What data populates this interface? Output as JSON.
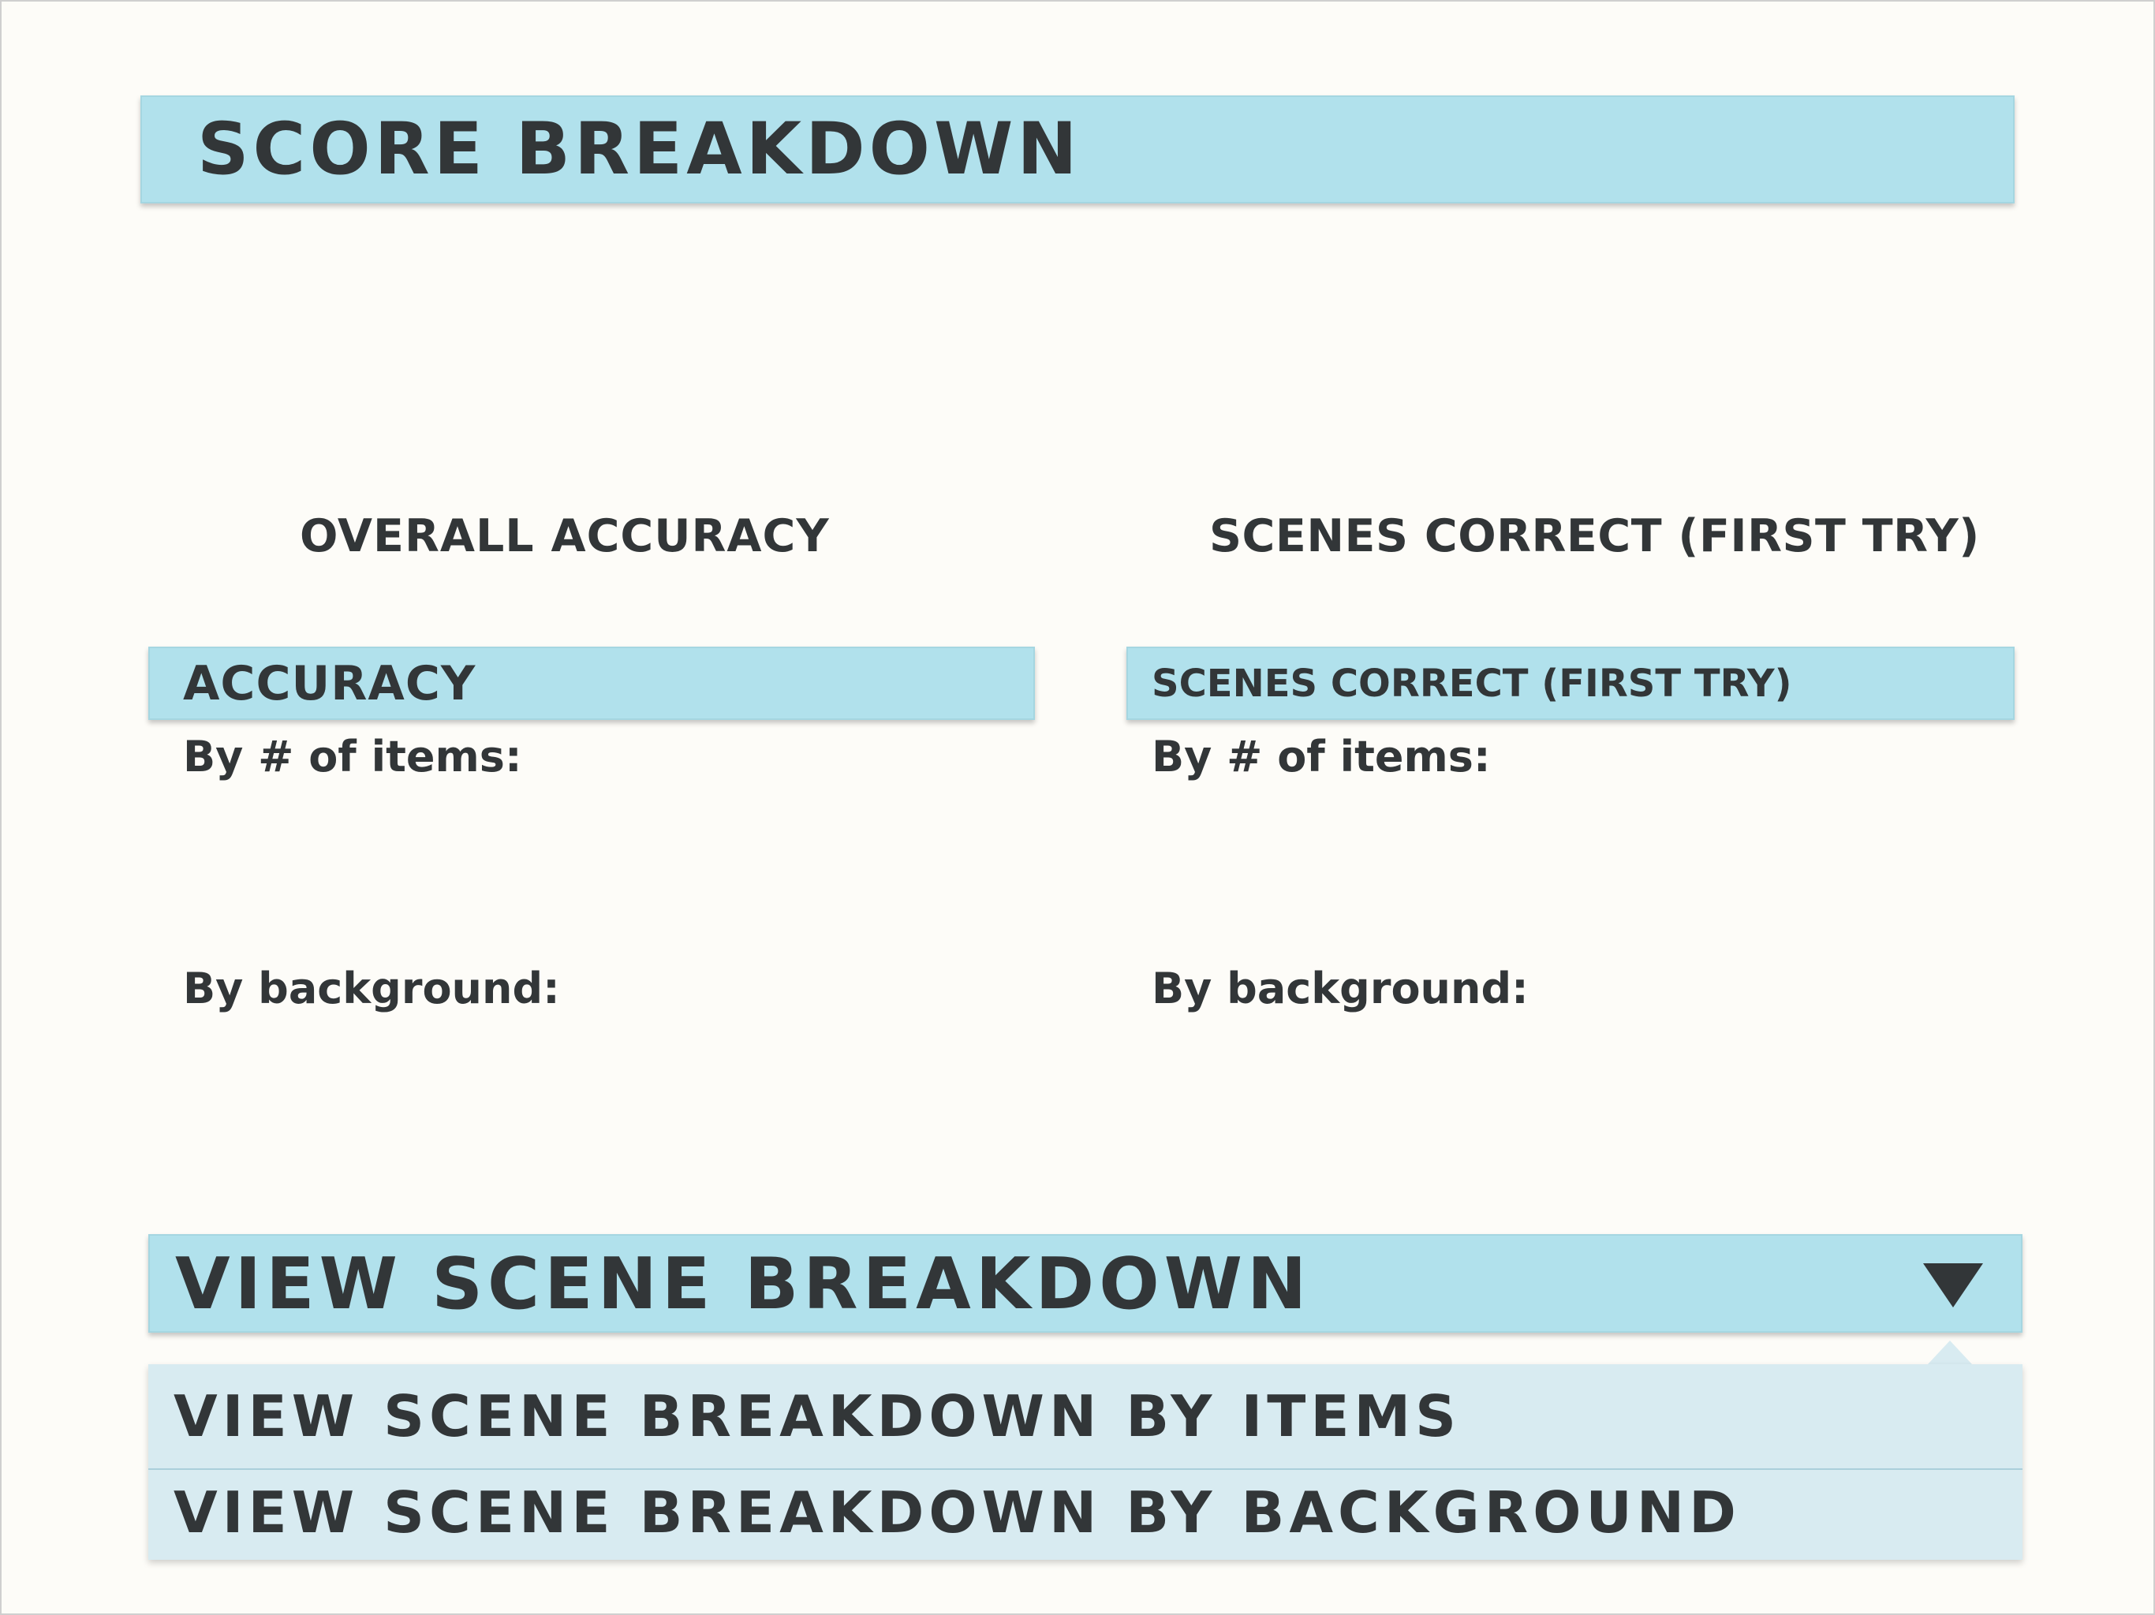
{
  "header": {
    "title": "SCORE BREAKDOWN"
  },
  "columns": {
    "left": {
      "heading": "OVERALL ACCURACY",
      "section_title": "ACCURACY",
      "by_items_label": "By # of items:",
      "by_background_label": "By background:"
    },
    "right": {
      "heading": "SCENES CORRECT (FIRST TRY)",
      "section_title": "SCENES CORRECT (FIRST TRY)",
      "by_items_label": "By # of items:",
      "by_background_label": "By background:"
    }
  },
  "dropdown": {
    "selected_label": "VIEW SCENE BREAKDOWN",
    "icon": "triangle-down-icon",
    "options": [
      "VIEW SCENE BREAKDOWN BY ITEMS",
      "VIEW SCENE BREAKDOWN BY BACKGROUND"
    ]
  },
  "colors": {
    "background": "#fdfcf8",
    "bar": "#b1e1ec",
    "menu": "#d8ebf1",
    "text": "#323638"
  }
}
